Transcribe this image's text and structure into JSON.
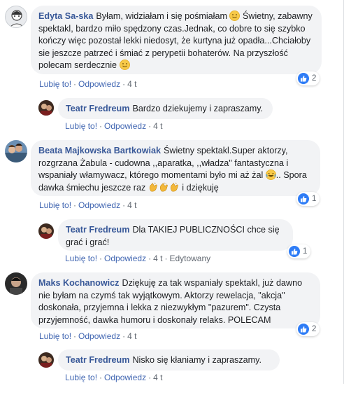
{
  "comments": [
    {
      "author": "Edyta Sa-ska",
      "text_part1": "Byłam, widziałam i się pośmiałam ",
      "text_part2": " Świetny, zabawny spektakl, bardzo miło spędzony czas.Jednak, co dobre to się szybko kończy więc pozostał lekki niedosyt, że kurtyna już opadła...Chciałoby sie jeszcze patrzeć i śmiać z perypetii bohaterów. Na przyszłość polecam serdecznie ",
      "like": "Lubię to!",
      "reply": "Odpowiedz",
      "time": "4 t",
      "reactions": "2"
    },
    {
      "author": "Teatr Fredreum",
      "text": "Bardzo dziekujemy i zapraszamy.",
      "like": "Lubię to!",
      "reply": "Odpowiedz",
      "time": "4 t"
    },
    {
      "author": "Beata Majkowska Bartkowiak",
      "text_part1": "Świetny spektakl.Super aktorzy, rozgrzana Żabula - cudowna ,,aparatka, ,,władza\" fantastyczna i wspaniały włamywacz, którego momentami było mi aż żal ",
      "text_part2": ".. Spora dawka śmiechu jeszcze raz ",
      "text_part3": " i dziękuję",
      "like": "Lubię to!",
      "reply": "Odpowiedz",
      "time": "4 t",
      "reactions": "1"
    },
    {
      "author": "Teatr Fredreum",
      "text": "Dla TAKIEJ PUBLICZNOŚCI chce się grać i grać!",
      "like": "Lubię to!",
      "reply": "Odpowiedz",
      "time": "4 t",
      "edited": "Edytowany",
      "reactions": "1"
    },
    {
      "author": "Maks Kochanowicz",
      "text": "Dziękuję za tak wspaniały spektakl, już dawno nie byłam na czymś tak wyjątkowym. Aktorzy rewelacja, \"akcja\" doskonała, przyjemna i lekka z niezwykłym \"pazurem\". Czysta przyjemność, dawka humoru i doskonały relaks. POLECAM",
      "like": "Lubię to!",
      "reply": "Odpowiedz",
      "time": "4 t",
      "reactions": "2"
    },
    {
      "author": "Teatr Fredreum",
      "text": "Nisko się kłaniamy i zapraszamy.",
      "like": "Lubię to!",
      "reply": "Odpowiedz",
      "time": "4 t"
    }
  ],
  "separator": "·",
  "colors": {
    "author": "#385898",
    "link": "#4267b2",
    "bubble": "#f2f3f5",
    "like_blue": "#2e7cf6"
  }
}
